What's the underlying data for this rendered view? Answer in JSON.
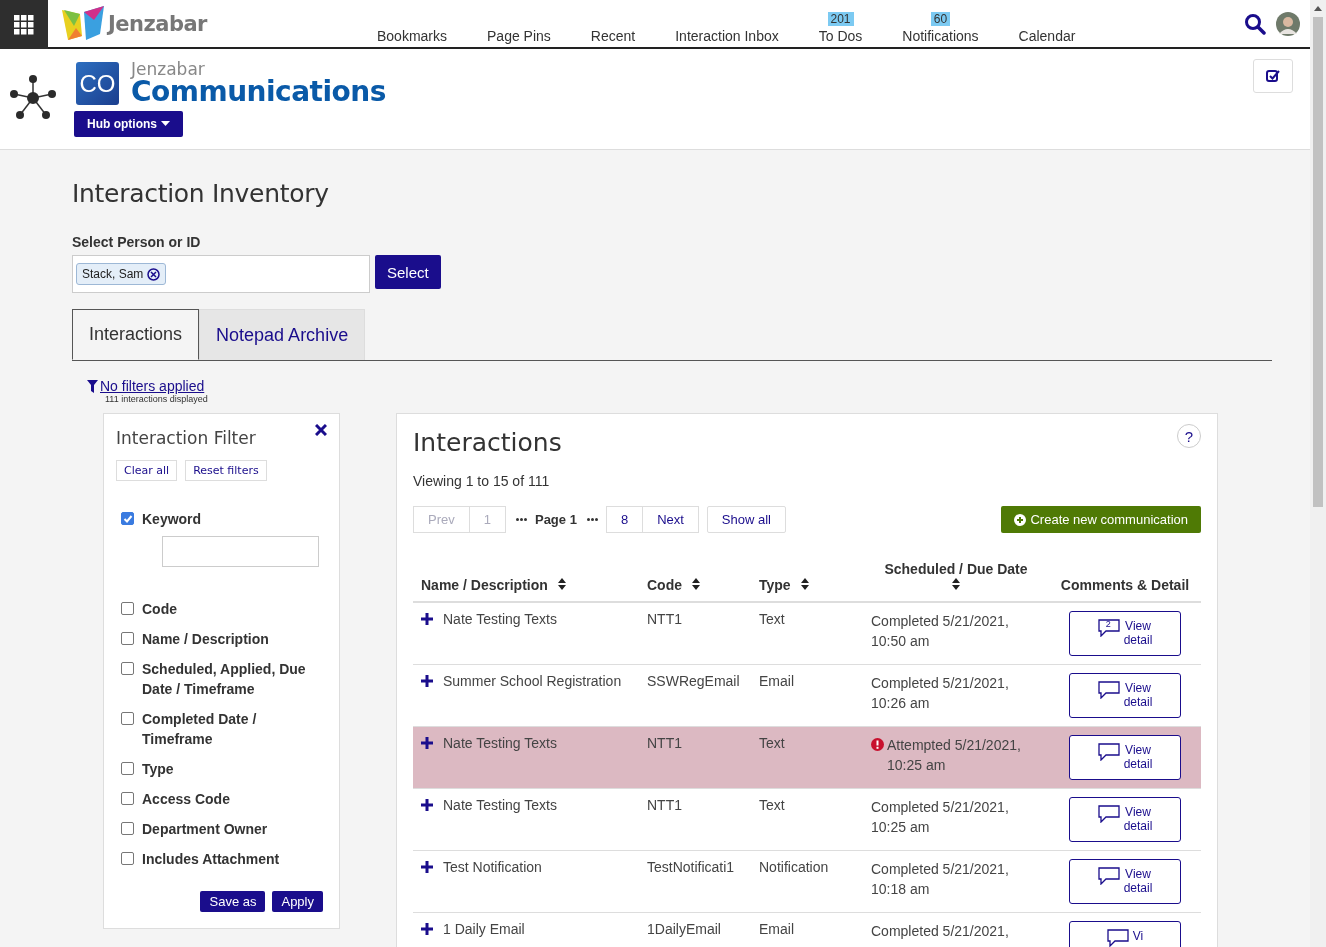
{
  "topnav": {
    "brand": "Jenzabar",
    "links": [
      {
        "label": "Bookmarks"
      },
      {
        "label": "Page Pins"
      },
      {
        "label": "Recent"
      },
      {
        "label": "Interaction Inbox"
      },
      {
        "label": "To Dos",
        "badge": "201"
      },
      {
        "label": "Notifications",
        "badge": "60"
      },
      {
        "label": "Calendar"
      }
    ]
  },
  "hub": {
    "logo_text": "CO",
    "vendor": "Jenzabar",
    "title": "Communications",
    "options_button": "Hub options"
  },
  "page_title": "Interaction Inventory",
  "person": {
    "label": "Select Person or ID",
    "token": "Stack, Sam",
    "button": "Select"
  },
  "tabs": [
    {
      "label": "Interactions",
      "selected": true
    },
    {
      "label": "Notepad Archive",
      "selected": false
    }
  ],
  "filter_summary": {
    "link": "No filters applied",
    "count": "111 interactions displayed"
  },
  "filter": {
    "title": "Interaction Filter",
    "buttons": [
      "Clear all",
      "Reset filters"
    ],
    "options": [
      {
        "label": "Keyword",
        "checked": true,
        "kind": "text"
      },
      {
        "label": "Code",
        "checked": false,
        "kind": "plain"
      },
      {
        "label": "Name / Description",
        "checked": false,
        "kind": "plain"
      },
      {
        "label": "Scheduled, Applied, Due Date / Timeframe",
        "checked": false,
        "kind": "plain"
      },
      {
        "label": "Completed Date / Timeframe",
        "checked": false,
        "kind": "plain"
      },
      {
        "label": "Type",
        "checked": false,
        "kind": "plain"
      },
      {
        "label": "Access Code",
        "checked": false,
        "kind": "plain"
      },
      {
        "label": "Department Owner",
        "checked": false,
        "kind": "plain"
      },
      {
        "label": "Includes Attachment",
        "checked": false,
        "kind": "plain"
      }
    ],
    "save": "Save as",
    "apply": "Apply"
  },
  "interactions": {
    "title": "Interactions",
    "help": "?",
    "viewing": "Viewing 1 to 15 of 111",
    "pager": {
      "prev": "Prev",
      "first": "1",
      "current": "Page 1",
      "last": "8",
      "next": "Next",
      "show_all": "Show all"
    },
    "create": "Create new communication",
    "columns": [
      "Name / Description",
      "Code",
      "Type",
      "Scheduled / Due Date",
      "Comments & Detail"
    ],
    "rows": [
      {
        "name": "Nate Testing Texts",
        "code": "NTT1",
        "type": "Text",
        "date": "Completed 5/21/2021,",
        "time": "10:50 am",
        "failed": false,
        "comments": "2",
        "action": "View",
        "action2": "detail"
      },
      {
        "name": "Summer School Registration",
        "code": "SSWRegEmail",
        "type": "Email",
        "date": "Completed 5/21/2021,",
        "time": "10:26 am",
        "failed": false,
        "action": "View",
        "action2": "detail"
      },
      {
        "name": "Nate Testing Texts",
        "code": "NTT1",
        "type": "Text",
        "date": "Attempted 5/21/2021,",
        "time": "10:25 am",
        "failed": true,
        "action": "View",
        "action2": "detail"
      },
      {
        "name": "Nate Testing Texts",
        "code": "NTT1",
        "type": "Text",
        "date": "Completed 5/21/2021,",
        "time": "10:25 am",
        "failed": false,
        "action": "View",
        "action2": "detail"
      },
      {
        "name": "Test Notification",
        "code": "TestNotificati1",
        "type": "Notification",
        "date": "Completed 5/21/2021,",
        "time": "10:18 am",
        "failed": false,
        "action": "View",
        "action2": "detail"
      },
      {
        "name": "1 Daily Email",
        "code": "1DailyEmail",
        "type": "Email",
        "date": "Completed 5/21/2021,",
        "failed": false,
        "action": "Vi"
      }
    ]
  }
}
